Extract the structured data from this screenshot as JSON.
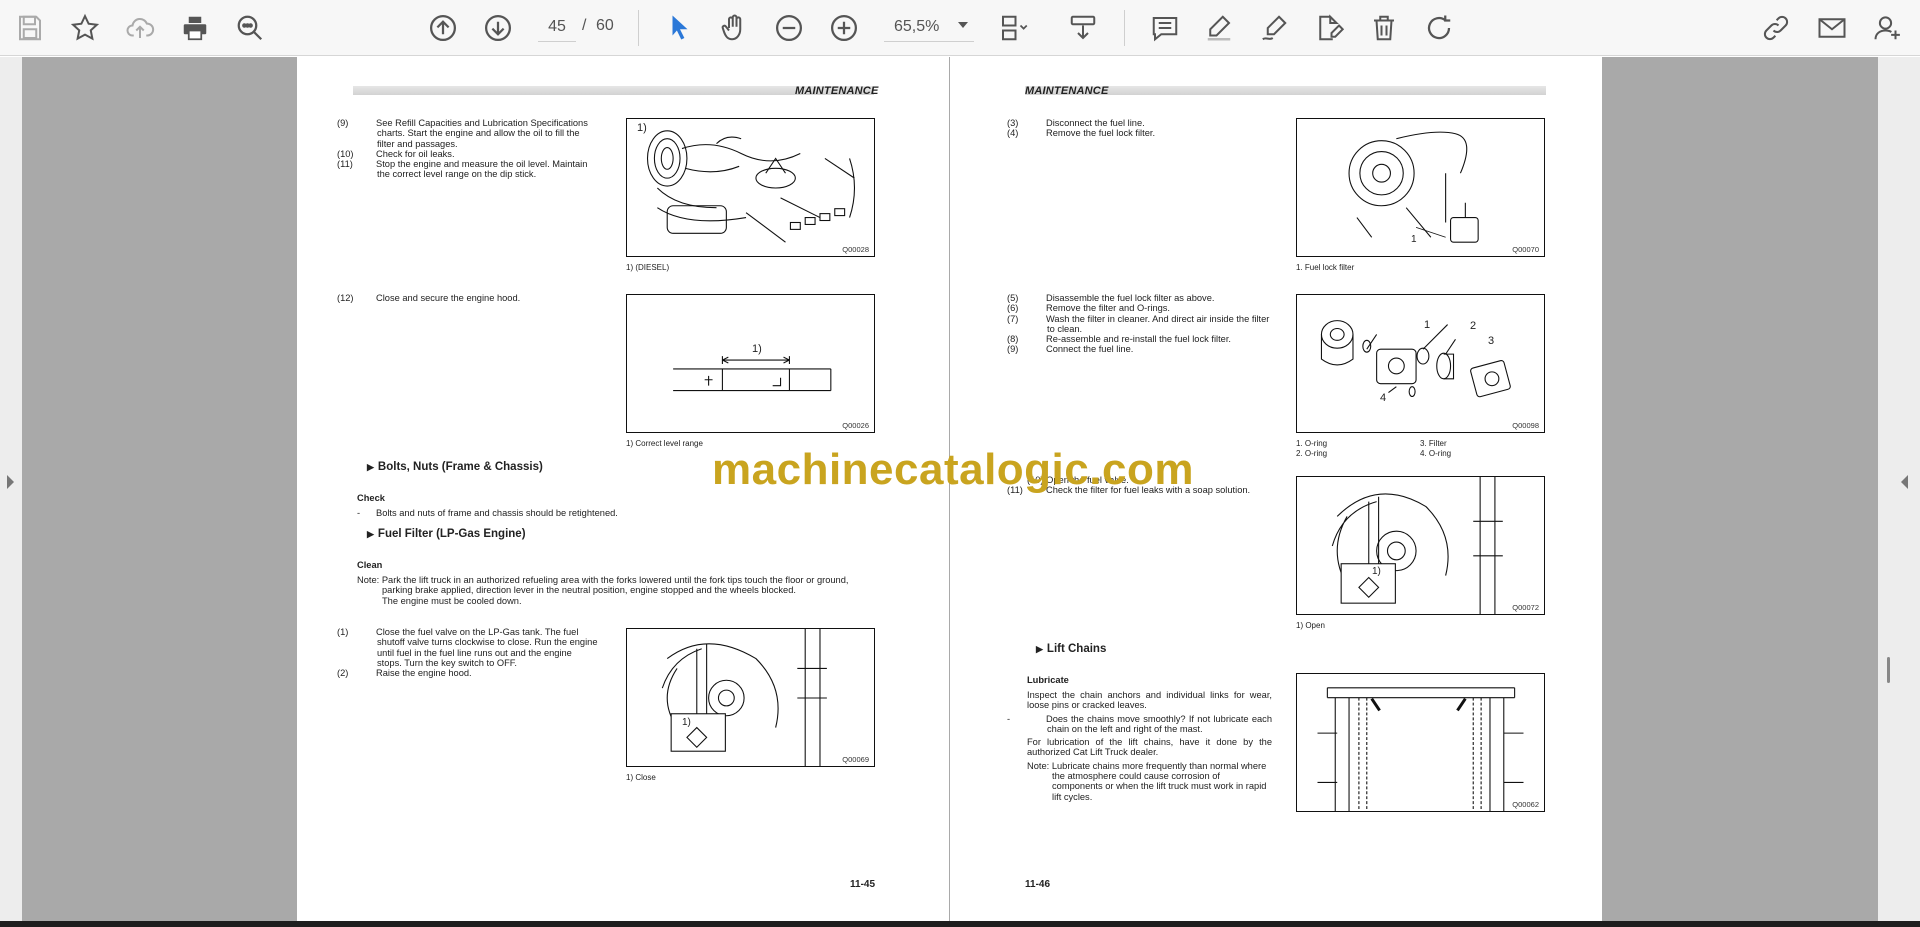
{
  "toolbar": {
    "page_current": "45",
    "page_separator": "/",
    "page_total": "60",
    "zoom": "65,5%",
    "icons": [
      "save-icon",
      "bookmark-star-icon",
      "cloud-upload-icon",
      "print-icon",
      "find-icon",
      "previous-page-icon",
      "next-page-icon",
      "select-cursor-icon",
      "hand-tool-icon",
      "zoom-out-icon",
      "zoom-in-icon",
      "page-layout-icon",
      "download-icon",
      "comment-icon",
      "highlight-pen-icon",
      "draw-icon",
      "sign-document-icon",
      "delete-icon",
      "rotate-icon",
      "attach-link-icon",
      "email-icon",
      "add-user-icon"
    ],
    "accent_color": "#2b78d8"
  },
  "left_page": {
    "header": "MAINTENANCE",
    "step9": "See Refill Capacities and Lubrication Specifications charts. Start the engine and allow the oil to fill the filter and passages.",
    "step10": "Check for oil leaks.",
    "step11": "Stop the engine and measure the oil level. Maintain the correct level range on the dip stick.",
    "step12": "Close and secure the engine hood.",
    "fig1_label": "1)",
    "fig1_code": "Q00028",
    "fig1_caption": "1) (DIESEL)",
    "fig2_label": "1)",
    "fig2_code": "Q00026",
    "fig2_caption": "1) Correct level range",
    "section1_title": "Bolts, Nuts (Frame & Chassis)",
    "check_title": "Check",
    "check_dash": "-",
    "check_text": "Bolts and nuts of frame and chassis should be retightened.",
    "section2_title": "Fuel Filter (LP-Gas Engine)",
    "clean_title": "Clean",
    "note_label": "Note:",
    "note_line1": "Park the lift truck in an authorized refueling area with the forks lowered until the fork tips touch the floor or ground,",
    "note_line2": "parking brake applied, direction lever in the neutral position, engine stopped and the wheels blocked.",
    "note_line3": "The engine must be cooled down.",
    "stepA": "Close the fuel valve on the LP-Gas tank. The fuel shutoff valve turns clockwise to close. Run the engine until fuel in the fuel line runs out and the engine stops. Turn the key switch to OFF.",
    "stepB": "Raise the engine hood.",
    "fig3_label": "1)",
    "fig3_code": "Q00069",
    "fig3_caption": "1) Close",
    "page_number": "11-45"
  },
  "right_page": {
    "header": "MAINTENANCE",
    "step3": "Disconnect the fuel line.",
    "step4": "Remove the fuel lock filter.",
    "fig1_label": "1",
    "fig1_code": "Q00070",
    "fig1_caption": "1. Fuel lock filter",
    "step5": "Disassemble the fuel lock filter as above.",
    "step6": "Remove the filter and O-rings.",
    "step7": "Wash the filter in cleaner. And direct air inside the filter to clean.",
    "step8": "Re-assemble and re-install the fuel lock filter.",
    "step9": "Connect the fuel line.",
    "fig2_labels": [
      "1",
      "2",
      "3",
      "4"
    ],
    "fig2_code": "Q00098",
    "fig2_caption": [
      "1. O-ring",
      "3. Filter",
      "2. O-ring",
      "4. O-ring"
    ],
    "step10_partial": "(10) Open the fuel valve.",
    "step11": "Check the filter for fuel leaks with a soap solution.",
    "fig3_label": "1)",
    "fig3_code": "Q00072",
    "fig3_caption": "1) Open",
    "section_title": "Lift Chains",
    "lubricate_title": "Lubricate",
    "lub_text": "Inspect the chain anchors and individual links for wear, loose pins or cracked leaves.",
    "lub_dash": "-",
    "lub_bullet": "Does the chains move smoothly? If not lubricate each chain on the left and right of the mast.",
    "lub_text2": "For lubrication of the lift chains, have it done by the authorized Cat Lift Truck dealer.",
    "note_label": "Note:",
    "note_text": "Lubricate chains more frequently than normal where the atmosphere could cause corrosion of components or when the lift truck must work in rapid lift cycles.",
    "fig4_code": "Q00062",
    "page_number": "11-46"
  },
  "watermark": "machinecatalogic.com"
}
